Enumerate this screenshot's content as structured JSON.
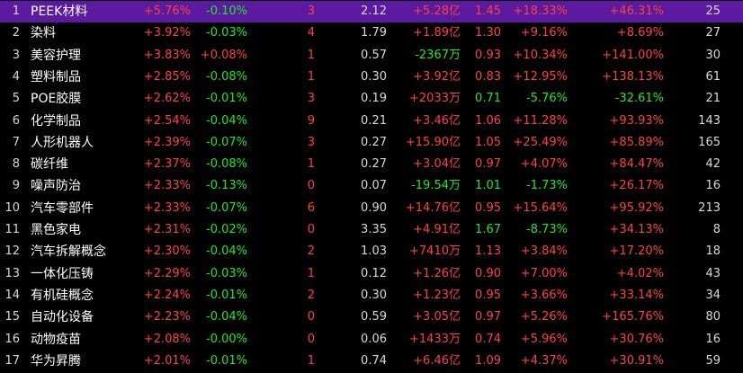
{
  "colors": {
    "up": "#ff4040",
    "down": "#22e822",
    "neutral": "#d8d8d8",
    "selected_bg": "#5b1a9f"
  },
  "rows": [
    {
      "idx": "1",
      "name": "PEEK材料",
      "chg": "+5.76%",
      "spd": "-0.10%",
      "cnt": "3",
      "vr": "2.12",
      "amt": "+5.28亿",
      "tr": "1.45",
      "c5": "+18.33%",
      "yr": "+46.31%",
      "days": "25",
      "selected": true
    },
    {
      "idx": "2",
      "name": "染料",
      "chg": "+3.92%",
      "spd": "-0.03%",
      "cnt": "4",
      "vr": "1.79",
      "amt": "+1.89亿",
      "tr": "1.30",
      "c5": "+9.16%",
      "yr": "+8.69%",
      "days": "27"
    },
    {
      "idx": "3",
      "name": "美容护理",
      "chg": "+3.83%",
      "spd": "+0.08%",
      "cnt": "1",
      "vr": "0.57",
      "amt": "-2367万",
      "tr": "0.93",
      "c5": "+10.34%",
      "yr": "+141.00%",
      "days": "30"
    },
    {
      "idx": "4",
      "name": "塑料制品",
      "chg": "+2.85%",
      "spd": "-0.08%",
      "cnt": "1",
      "vr": "0.30",
      "amt": "+3.92亿",
      "tr": "0.83",
      "c5": "+12.95%",
      "yr": "+138.13%",
      "days": "61"
    },
    {
      "idx": "5",
      "name": "POE胶膜",
      "chg": "+2.62%",
      "spd": "-0.01%",
      "cnt": "3",
      "vr": "0.19",
      "amt": "+2033万",
      "tr": "0.71",
      "c5": "-5.76%",
      "yr": "-32.61%",
      "days": "21"
    },
    {
      "idx": "6",
      "name": "化学制品",
      "chg": "+2.54%",
      "spd": "-0.04%",
      "cnt": "9",
      "vr": "0.21",
      "amt": "+3.46亿",
      "tr": "1.06",
      "c5": "+11.28%",
      "yr": "+93.93%",
      "days": "143"
    },
    {
      "idx": "7",
      "name": "人形机器人",
      "chg": "+2.39%",
      "spd": "-0.07%",
      "cnt": "3",
      "vr": "0.27",
      "amt": "+15.90亿",
      "tr": "1.05",
      "c5": "+25.49%",
      "yr": "+85.89%",
      "days": "165"
    },
    {
      "idx": "8",
      "name": "碳纤维",
      "chg": "+2.37%",
      "spd": "-0.08%",
      "cnt": "1",
      "vr": "0.27",
      "amt": "+3.04亿",
      "tr": "0.97",
      "c5": "+4.07%",
      "yr": "+84.47%",
      "days": "42"
    },
    {
      "idx": "9",
      "name": "噪声防治",
      "chg": "+2.33%",
      "spd": "-0.13%",
      "cnt": "0",
      "vr": "0.07",
      "amt": "-19.54万",
      "tr": "1.01",
      "c5": "-1.73%",
      "yr": "+26.17%",
      "days": "16"
    },
    {
      "idx": "10",
      "name": "汽车零部件",
      "chg": "+2.33%",
      "spd": "-0.07%",
      "cnt": "6",
      "vr": "0.90",
      "amt": "+14.76亿",
      "tr": "0.95",
      "c5": "+15.64%",
      "yr": "+95.92%",
      "days": "213"
    },
    {
      "idx": "11",
      "name": "黑色家电",
      "chg": "+2.31%",
      "spd": "-0.02%",
      "cnt": "0",
      "vr": "3.35",
      "amt": "+4.91亿",
      "tr": "1.67",
      "c5": "-8.73%",
      "yr": "+34.13%",
      "days": "8"
    },
    {
      "idx": "12",
      "name": "汽车拆解概念",
      "chg": "+2.30%",
      "spd": "-0.04%",
      "cnt": "2",
      "vr": "1.03",
      "amt": "+7410万",
      "tr": "1.13",
      "c5": "+3.84%",
      "yr": "+17.20%",
      "days": "18"
    },
    {
      "idx": "13",
      "name": "一体化压铸",
      "chg": "+2.29%",
      "spd": "-0.03%",
      "cnt": "1",
      "vr": "0.12",
      "amt": "+1.26亿",
      "tr": "0.90",
      "c5": "+7.00%",
      "yr": "+4.02%",
      "days": "43"
    },
    {
      "idx": "14",
      "name": "有机硅概念",
      "chg": "+2.24%",
      "spd": "-0.01%",
      "cnt": "2",
      "vr": "0.30",
      "amt": "+1.23亿",
      "tr": "0.95",
      "c5": "+3.66%",
      "yr": "+33.14%",
      "days": "34"
    },
    {
      "idx": "15",
      "name": "自动化设备",
      "chg": "+2.23%",
      "spd": "-0.04%",
      "cnt": "0",
      "vr": "0.59",
      "amt": "+3.05亿",
      "tr": "0.97",
      "c5": "+5.26%",
      "yr": "+165.76%",
      "days": "80"
    },
    {
      "idx": "16",
      "name": "动物疫苗",
      "chg": "+2.08%",
      "spd": "-0.00%",
      "cnt": "0",
      "vr": "0.06",
      "amt": "+1433万",
      "tr": "0.74",
      "c5": "+5.96%",
      "yr": "+30.76%",
      "days": "16"
    },
    {
      "idx": "17",
      "name": "华为昇腾",
      "chg": "+2.01%",
      "spd": "-0.01%",
      "cnt": "1",
      "vr": "0.74",
      "amt": "+6.46亿",
      "tr": "1.09",
      "c5": "+4.37%",
      "yr": "+30.91%",
      "days": "59"
    }
  ]
}
